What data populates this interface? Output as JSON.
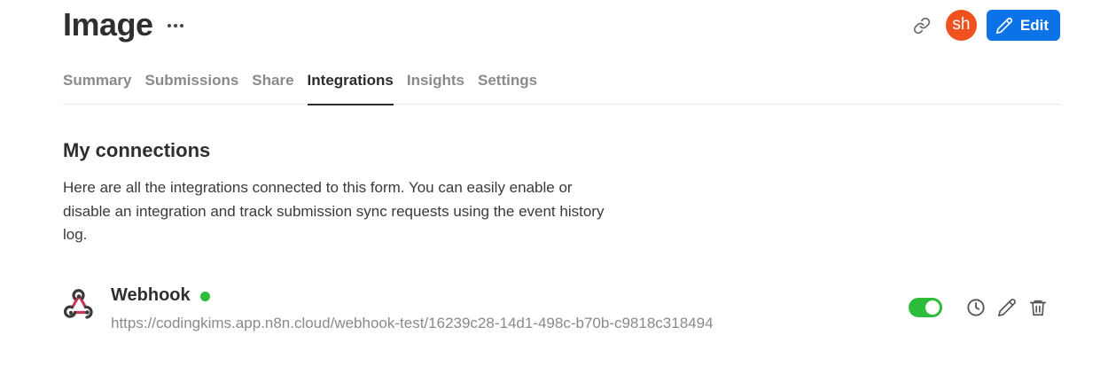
{
  "header": {
    "title": "Image",
    "avatar_initials": "sh",
    "edit_label": "Edit",
    "colors": {
      "avatar": "#f0521f",
      "primary": "#0b72e7"
    },
    "icons": [
      "more-options-icon",
      "link-icon",
      "pencil-icon"
    ]
  },
  "tabs": [
    {
      "label": "Summary",
      "active": false
    },
    {
      "label": "Submissions",
      "active": false
    },
    {
      "label": "Share",
      "active": false
    },
    {
      "label": "Integrations",
      "active": true
    },
    {
      "label": "Insights",
      "active": false
    },
    {
      "label": "Settings",
      "active": false
    }
  ],
  "connections": {
    "title": "My connections",
    "description": "Here are all the integrations connected to this form. You can easily enable or disable an integration and track submission sync requests using the event history log.",
    "items": [
      {
        "name": "Webhook",
        "status": "active",
        "status_color": "#2ebd3b",
        "url": "https://codingkims.app.n8n.cloud/webhook-test/16239c28-14d1-498c-b70b-c9818c318494",
        "enabled": true,
        "icons": [
          "webhook-icon",
          "history-icon",
          "edit-icon",
          "trash-icon"
        ]
      }
    ]
  }
}
